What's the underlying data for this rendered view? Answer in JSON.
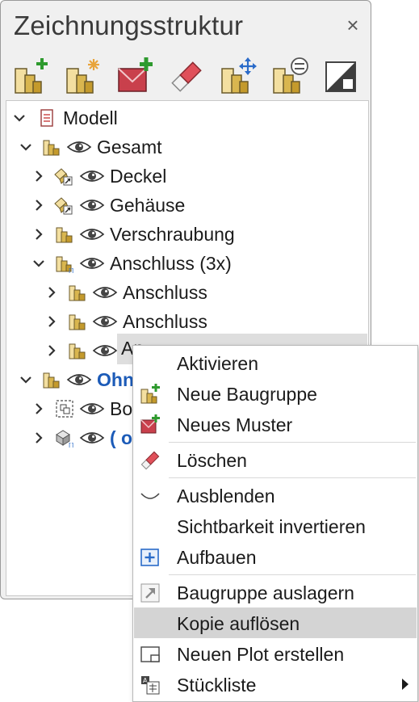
{
  "panel": {
    "title": "Zeichnungsstruktur",
    "close_glyph": "×",
    "toolbar": [
      {
        "name": "new-assembly-icon"
      },
      {
        "name": "new-assembly-star-icon"
      },
      {
        "name": "new-pattern-icon"
      },
      {
        "name": "eraser-icon"
      },
      {
        "name": "move-assembly-icon"
      },
      {
        "name": "assembly-settings-icon"
      },
      {
        "name": "plot-frame-icon"
      }
    ]
  },
  "tree": {
    "rows": [
      {
        "label": "Modell"
      },
      {
        "label": "Gesamt"
      },
      {
        "label": "Deckel"
      },
      {
        "label": "Gehäuse"
      },
      {
        "label": "Verschraubung"
      },
      {
        "label": "Anschluss (3x)"
      },
      {
        "label": "Anschluss"
      },
      {
        "label": "Anschluss"
      },
      {
        "label": "An"
      },
      {
        "label": "Ohn"
      },
      {
        "label": "Bo"
      },
      {
        "label": "( o"
      }
    ]
  },
  "context_menu": {
    "items": [
      {
        "label": "Aktivieren",
        "icon": ""
      },
      {
        "label": "Neue Baugruppe",
        "icon": "new-assembly-icon"
      },
      {
        "label": "Neues Muster",
        "icon": "new-pattern-icon"
      },
      {
        "label": "Löschen",
        "icon": "eraser-icon"
      },
      {
        "label": "Ausblenden",
        "icon": "hide-icon"
      },
      {
        "label": "Sichtbarkeit invertieren",
        "icon": ""
      },
      {
        "label": "Aufbauen",
        "icon": "build-plus-icon"
      },
      {
        "label": "Baugruppe auslagern",
        "icon": "export-assembly-icon"
      },
      {
        "label": "Kopie auflösen",
        "icon": ""
      },
      {
        "label": "Neuen Plot erstellen",
        "icon": "plot-frame-icon"
      },
      {
        "label": "Stückliste",
        "icon": "parts-list-icon"
      }
    ],
    "highlighted_index": 8
  },
  "colors": {
    "accent_blue": "#1c5bb8",
    "assembly_yellow": "#d9b64f",
    "pattern_red": "#c9404c",
    "add_green": "#2e9a2e"
  }
}
